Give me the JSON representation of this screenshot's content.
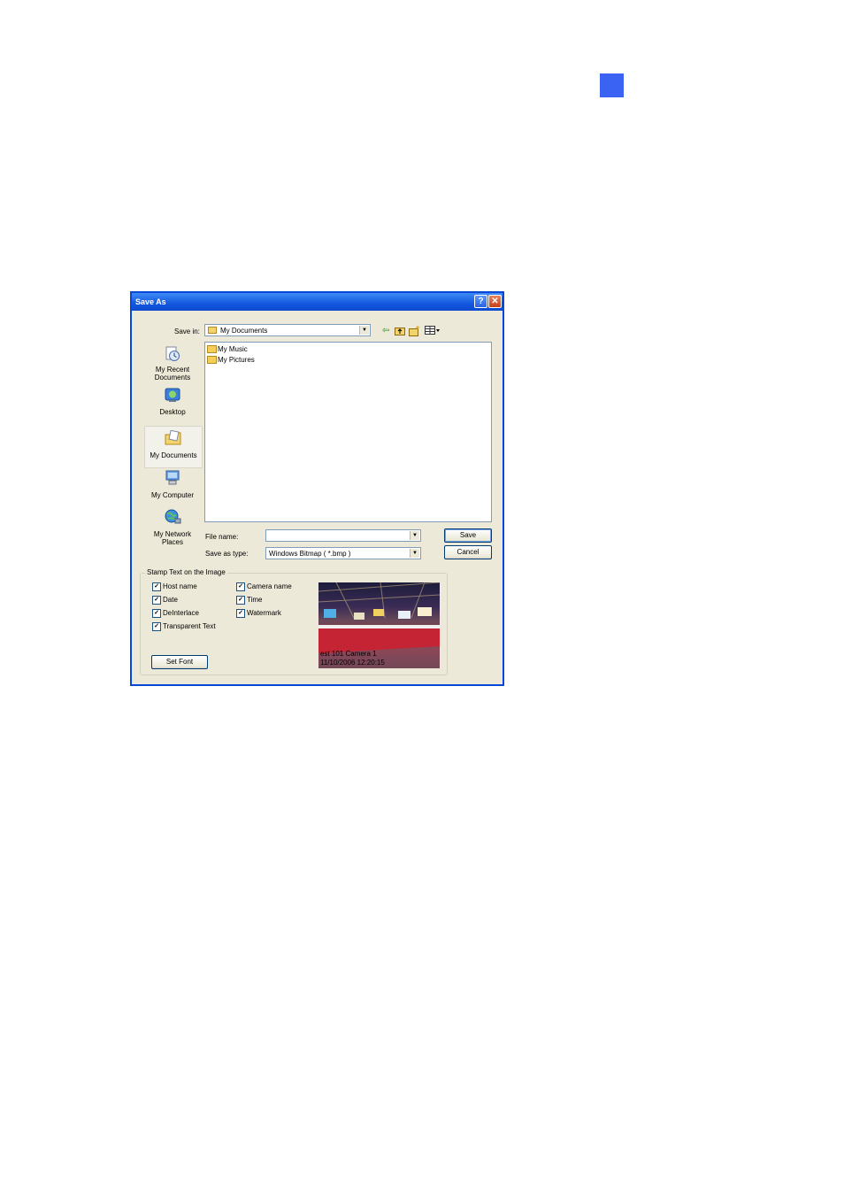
{
  "dialog": {
    "title": "Save As",
    "help_glyph": "?",
    "close_glyph": "✕"
  },
  "save_in": {
    "label": "Save in:",
    "value": "My Documents",
    "toolbar_icons": [
      "back-arrow-icon",
      "up-folder-icon",
      "new-folder-icon",
      "view-menu-icon"
    ]
  },
  "places": [
    {
      "label": "My Recent Documents",
      "icon": "recent-documents-icon"
    },
    {
      "label": "Desktop",
      "icon": "desktop-icon"
    },
    {
      "label": "My Documents",
      "icon": "my-documents-icon",
      "selected": true
    },
    {
      "label": "My Computer",
      "icon": "my-computer-icon"
    },
    {
      "label": "My Network Places",
      "icon": "network-places-icon"
    }
  ],
  "files": [
    {
      "name": "My Music"
    },
    {
      "name": "My Pictures"
    }
  ],
  "file_name": {
    "label": "File name:",
    "value": ""
  },
  "save_as_type": {
    "label": "Save as type:",
    "value": "Windows Bitmap ( *.bmp )"
  },
  "buttons": {
    "save": "Save",
    "cancel": "Cancel",
    "set_font": "Set Font"
  },
  "stamp": {
    "title": "Stamp Text on the Image",
    "options": {
      "host_name": "Host name",
      "camera_name": "Camera name",
      "date": "Date",
      "time": "Time",
      "deinterlace": "DeInterlace",
      "watermark": "Watermark",
      "transparent_text": "Transparent Text"
    },
    "check_glyph": "✓",
    "preview_line1": "est 101 Camera 1",
    "preview_line2": "11/10/2006 12:20:15"
  }
}
